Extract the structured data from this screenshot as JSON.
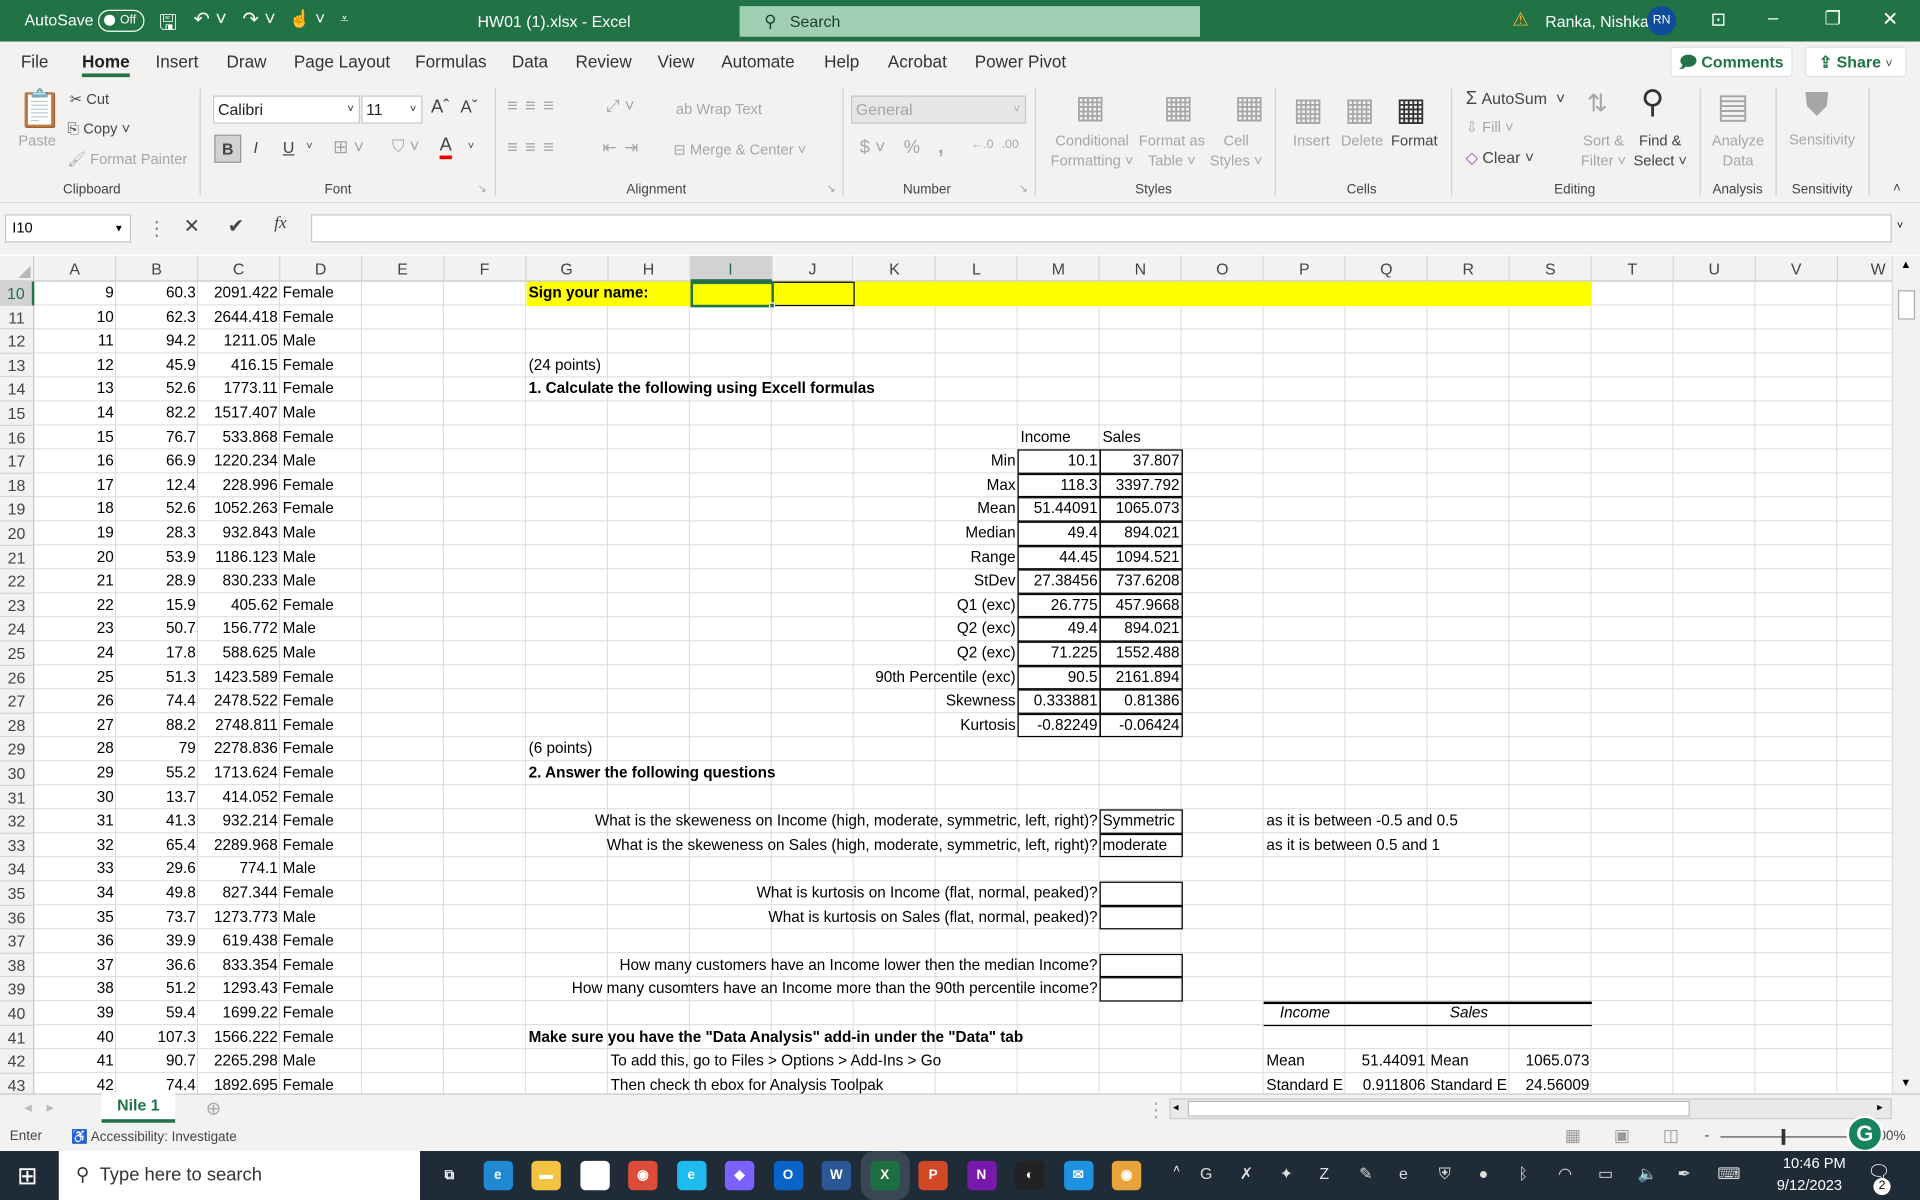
{
  "titlebar": {
    "autosave_label": "AutoSave",
    "autosave_state": "Off",
    "title": "HW01 (1).xlsx  -  Excel",
    "search_placeholder": "Search",
    "user_name": "Ranka, Nishka",
    "user_initials": "RN"
  },
  "menu": {
    "tabs": [
      "File",
      "Home",
      "Insert",
      "Draw",
      "Page Layout",
      "Formulas",
      "Data",
      "Review",
      "View",
      "Automate",
      "Help",
      "Acrobat",
      "Power Pivot"
    ],
    "active": "Home",
    "comments": "Comments",
    "share": "Share"
  },
  "ribbon": {
    "clipboard": {
      "paste": "Paste",
      "cut": "Cut",
      "copy": "Copy",
      "format_painter": "Format Painter",
      "label": "Clipboard"
    },
    "font": {
      "name": "Calibri",
      "size": "11",
      "label": "Font",
      "bold": "B",
      "italic": "I",
      "underline": "U"
    },
    "alignment": {
      "wrap": "Wrap Text",
      "merge": "Merge & Center",
      "label": "Alignment"
    },
    "number": {
      "format": "General",
      "label": "Number"
    },
    "styles": {
      "conditional": [
        "Conditional",
        "Formatting"
      ],
      "format_table": [
        "Format as",
        "Table"
      ],
      "cell_styles": [
        "Cell",
        "Styles"
      ],
      "label": "Styles"
    },
    "cells": {
      "insert": "Insert",
      "delete": "Delete",
      "format": "Format",
      "label": "Cells"
    },
    "editing": {
      "autosum": "AutoSum",
      "fill": "Fill",
      "clear": "Clear",
      "sort": [
        "Sort &",
        "Filter"
      ],
      "find": [
        "Find &",
        "Select"
      ],
      "label": "Editing"
    },
    "analysis": {
      "analyze": [
        "Analyze",
        "Data"
      ],
      "label": "Analysis"
    },
    "sensitivity": {
      "button": "Sensitivity",
      "label": "Sensitivity"
    }
  },
  "formula_bar": {
    "name_box": "I10",
    "formula": ""
  },
  "columns": [
    "A",
    "B",
    "C",
    "D",
    "E",
    "F",
    "G",
    "H",
    "I",
    "J",
    "K",
    "L",
    "M",
    "N",
    "O",
    "P",
    "Q",
    "R",
    "S",
    "T",
    "U",
    "V",
    "W"
  ],
  "first_row": 10,
  "data_rows": [
    [
      "9",
      "60.3",
      "2091.422",
      "Female"
    ],
    [
      "10",
      "62.3",
      "2644.418",
      "Female"
    ],
    [
      "11",
      "94.2",
      "1211.05",
      "Male"
    ],
    [
      "12",
      "45.9",
      "416.15",
      "Female"
    ],
    [
      "13",
      "52.6",
      "1773.11",
      "Female"
    ],
    [
      "14",
      "82.2",
      "1517.407",
      "Male"
    ],
    [
      "15",
      "76.7",
      "533.868",
      "Female"
    ],
    [
      "16",
      "66.9",
      "1220.234",
      "Male"
    ],
    [
      "17",
      "12.4",
      "228.996",
      "Female"
    ],
    [
      "18",
      "52.6",
      "1052.263",
      "Female"
    ],
    [
      "19",
      "28.3",
      "932.843",
      "Male"
    ],
    [
      "20",
      "53.9",
      "1186.123",
      "Male"
    ],
    [
      "21",
      "28.9",
      "830.233",
      "Male"
    ],
    [
      "22",
      "15.9",
      "405.62",
      "Female"
    ],
    [
      "23",
      "50.7",
      "156.772",
      "Male"
    ],
    [
      "24",
      "17.8",
      "588.625",
      "Male"
    ],
    [
      "25",
      "51.3",
      "1423.589",
      "Female"
    ],
    [
      "26",
      "74.4",
      "2478.522",
      "Female"
    ],
    [
      "27",
      "88.2",
      "2748.811",
      "Female"
    ],
    [
      "28",
      "79",
      "2278.836",
      "Female"
    ],
    [
      "29",
      "55.2",
      "1713.624",
      "Female"
    ],
    [
      "30",
      "13.7",
      "414.052",
      "Female"
    ],
    [
      "31",
      "41.3",
      "932.214",
      "Female"
    ],
    [
      "32",
      "65.4",
      "2289.968",
      "Female"
    ],
    [
      "33",
      "29.6",
      "774.1",
      "Male"
    ],
    [
      "34",
      "49.8",
      "827.344",
      "Female"
    ],
    [
      "35",
      "73.7",
      "1273.773",
      "Male"
    ],
    [
      "36",
      "39.9",
      "619.438",
      "Female"
    ],
    [
      "37",
      "36.6",
      "833.354",
      "Female"
    ],
    [
      "38",
      "51.2",
      "1293.43",
      "Female"
    ],
    [
      "39",
      "59.4",
      "1699.22",
      "Female"
    ],
    [
      "40",
      "107.3",
      "1566.222",
      "Female"
    ],
    [
      "41",
      "90.7",
      "2265.298",
      "Male"
    ],
    [
      "42",
      "74.4",
      "1892.695",
      "Female"
    ]
  ],
  "sheet": {
    "sign_name": "Sign your name:",
    "part1_points": "(24 points)",
    "part1_title": "1. Calculate the following using Excell formulas",
    "stats_headers": [
      "Income",
      "Sales"
    ],
    "stats": [
      {
        "label": "Min",
        "income": "10.1",
        "sales": "37.807"
      },
      {
        "label": "Max",
        "income": "118.3",
        "sales": "3397.792"
      },
      {
        "label": "Mean",
        "income": "51.44091",
        "sales": "1065.073"
      },
      {
        "label": "Median",
        "income": "49.4",
        "sales": "894.021"
      },
      {
        "label": "Range",
        "income": "44.45",
        "sales": "1094.521"
      },
      {
        "label": "StDev",
        "income": "27.38456",
        "sales": "737.6208"
      },
      {
        "label": "Q1 (exc)",
        "income": "26.775",
        "sales": "457.9668"
      },
      {
        "label": "Q2 (exc)",
        "income": "49.4",
        "sales": "894.021"
      },
      {
        "label": "Q2 (exc)",
        "income": "71.225",
        "sales": "1552.488"
      },
      {
        "label": "90th Percentile (exc)",
        "income": "90.5",
        "sales": "2161.894"
      },
      {
        "label": "Skewness",
        "income": "0.333881",
        "sales": "0.81386"
      },
      {
        "label": "Kurtosis",
        "income": "-0.82249",
        "sales": "-0.06424"
      }
    ],
    "part2_points": "(6 points)",
    "part2_title": "2. Answer the following questions",
    "questions": [
      {
        "row": 32,
        "q": "What is the skeweness on Income (high, moderate, symmetric, left, right)?",
        "a": "Symmetric",
        "note": "as it is between -0.5 and 0.5"
      },
      {
        "row": 33,
        "q": "What is the skeweness on Sales (high, moderate, symmetric, left, right)?",
        "a": "moderate",
        "note": "as it is between 0.5 and 1"
      },
      {
        "row": 35,
        "q": "What is kurtosis on Income (flat, normal, peaked)?",
        "a": "",
        "note": ""
      },
      {
        "row": 36,
        "q": "What is kurtosis on Sales (flat, normal, peaked)?",
        "a": "",
        "note": ""
      },
      {
        "row": 38,
        "q": "How many customers have an Income lower then the median Income?",
        "a": "",
        "note": ""
      },
      {
        "row": 39,
        "q": "How many cusomters have an Income more than the 90th percentile income?",
        "a": "",
        "note": ""
      }
    ],
    "addin_title": "Make sure you have the \"Data Analysis\" add-in under the \"Data\" tab",
    "addin_step1": "To add this, go to Files > Options > Add-Ins > Go",
    "addin_step2": "Then check th ebox for Analysis Toolpak",
    "desc_headers": [
      "Income",
      "Sales"
    ],
    "desc_rows": [
      [
        "Mean",
        "51.44091",
        "Mean",
        "1065.073"
      ],
      [
        "Standard E",
        "0.911806",
        "Standard E",
        "24.56009"
      ]
    ]
  },
  "sheet_tab": "Nile 1",
  "status": {
    "mode": "Enter",
    "accessibility": "Accessibility: Investigate",
    "zoom": "100%"
  },
  "taskbar": {
    "search_placeholder": "Type here to search",
    "time": "10:46 PM",
    "date": "9/12/2023",
    "notifications": "2"
  },
  "colors": {
    "excel_green": "#217346",
    "highlight_yellow": "#ffff00",
    "avatar_blue": "#0f4c9b"
  }
}
